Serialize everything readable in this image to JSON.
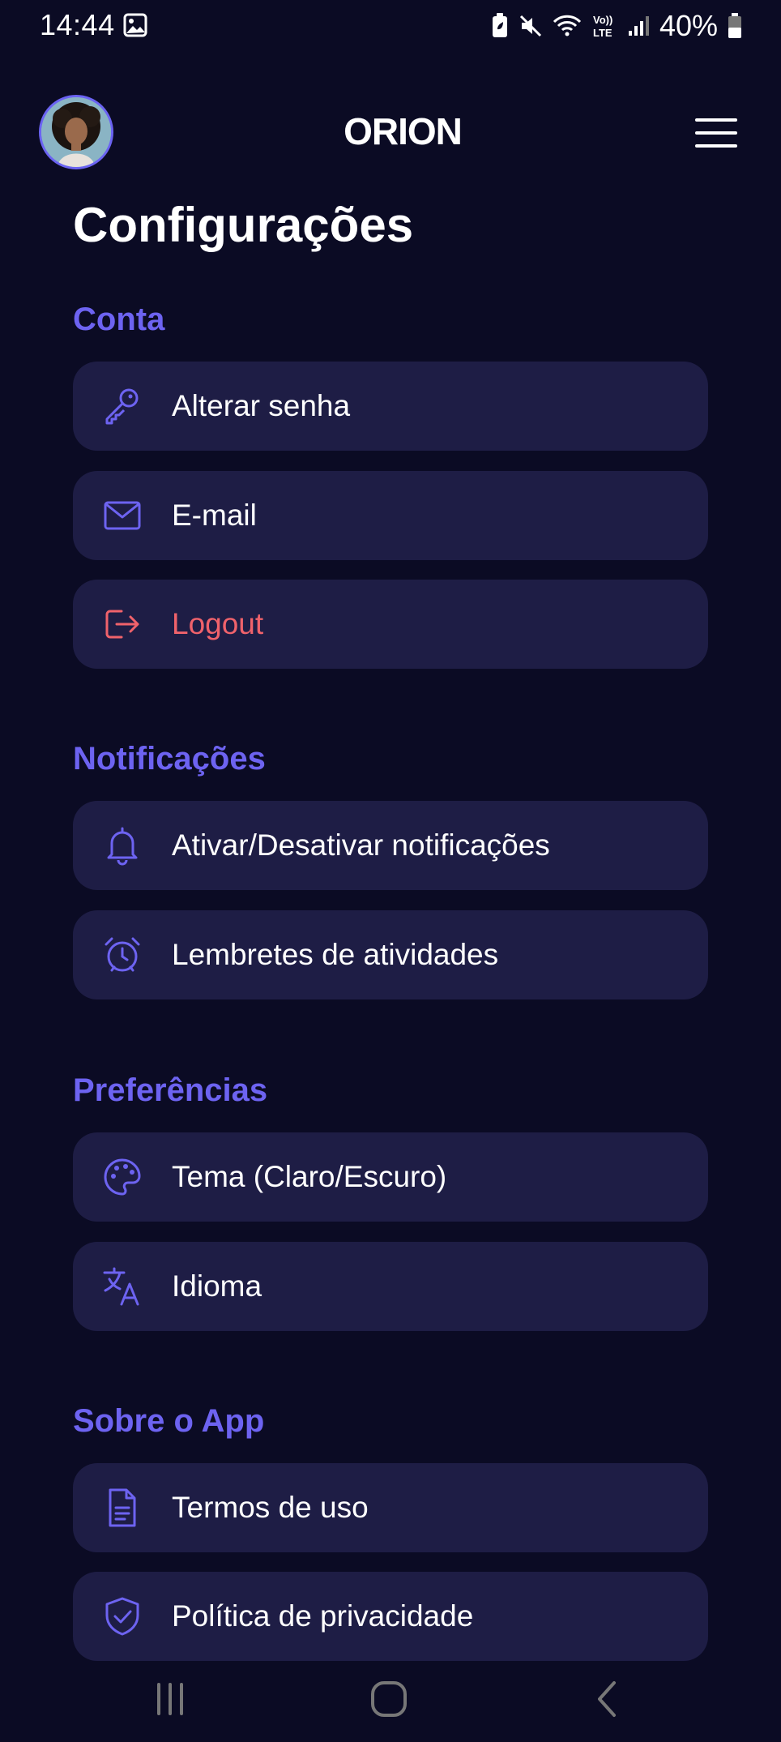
{
  "status_bar": {
    "time": "14:44",
    "battery_percent": "40%",
    "icons": [
      "gallery-icon",
      "battery-saver-icon",
      "mute-icon",
      "wifi-icon",
      "volte-icon",
      "signal-icon",
      "battery-icon"
    ]
  },
  "header": {
    "logo_text": "ORION",
    "avatar_icon": "avatar",
    "menu_icon": "hamburger-menu-icon"
  },
  "page": {
    "title": "Configurações"
  },
  "colors": {
    "background": "#0b0b24",
    "card": "#1e1d45",
    "accent": "#6d63f1",
    "danger": "#f0626b",
    "text": "#ffffff"
  },
  "sections": [
    {
      "title": "Conta",
      "items": [
        {
          "label": "Alterar senha",
          "icon": "key-icon"
        },
        {
          "label": "E-mail",
          "icon": "mail-icon"
        },
        {
          "label": "Logout",
          "icon": "logout-icon"
        }
      ]
    },
    {
      "title": "Notificações",
      "items": [
        {
          "label": "Ativar/Desativar notificações",
          "icon": "bell-icon"
        },
        {
          "label": "Lembretes de atividades",
          "icon": "alarm-icon"
        }
      ]
    },
    {
      "title": "Preferências",
      "items": [
        {
          "label": "Tema (Claro/Escuro)",
          "icon": "palette-icon"
        },
        {
          "label": "Idioma",
          "icon": "translate-icon"
        }
      ]
    },
    {
      "title": "Sobre o App",
      "items": [
        {
          "label": "Termos de uso",
          "icon": "document-icon"
        },
        {
          "label": "Política de privacidade",
          "icon": "shield-icon"
        }
      ]
    }
  ],
  "nav_bar": {
    "recent": "recent-apps-icon",
    "home": "home-icon",
    "back": "back-icon"
  }
}
